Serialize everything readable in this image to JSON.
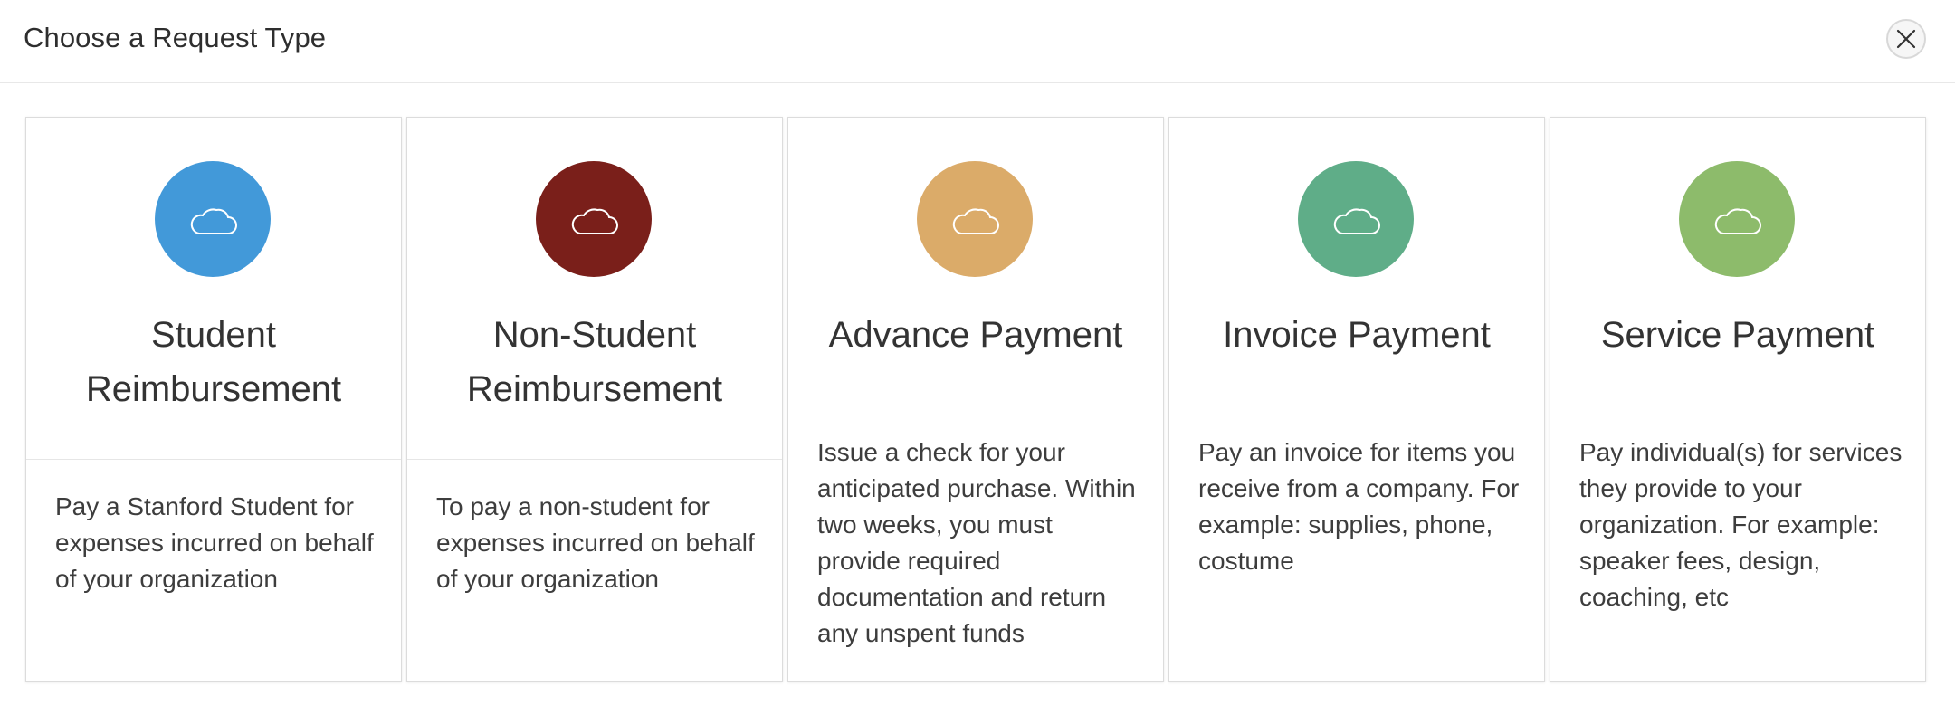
{
  "header": {
    "title": "Choose a Request Type",
    "close_icon": "close-icon"
  },
  "cards": [
    {
      "title": "Student Reimbursement",
      "description": "Pay a Stanford Student for expenses incurred on behalf of your organization",
      "icon": "cloud-icon",
      "color": "#4299d9"
    },
    {
      "title": "Non-Student Reimbursement",
      "description": "To pay a non-student for expenses incurred on behalf of your organization",
      "icon": "cloud-icon",
      "color": "#7a1f1a"
    },
    {
      "title": "Advance Payment",
      "description": "Issue a check for your anticipated purchase. Within two weeks, you must provide required documentation and return any unspent funds",
      "icon": "cloud-icon",
      "color": "#dbab69"
    },
    {
      "title": "Invoice Payment",
      "description": "Pay an invoice for items you receive from a company. For example: supplies, phone, costume",
      "icon": "cloud-icon",
      "color": "#5fad88"
    },
    {
      "title": "Service Payment",
      "description": "Pay individual(s) for services they provide to your organization. For example: speaker fees, design, coaching, etc",
      "icon": "cloud-icon",
      "color": "#8dbb6b"
    }
  ]
}
